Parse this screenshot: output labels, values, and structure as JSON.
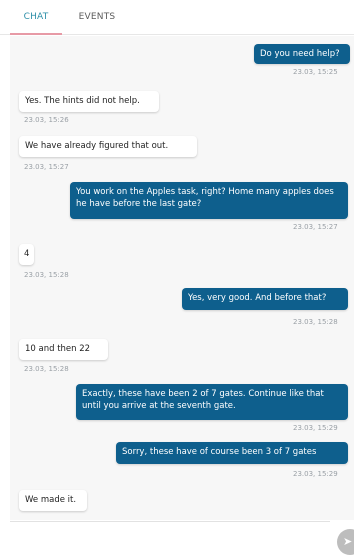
{
  "tabs": {
    "chat": "CHAT",
    "events": "EVENTS"
  },
  "messages": [
    {
      "direction": "out",
      "text": "Do you need help?",
      "time": "23.03, 15:25"
    },
    {
      "direction": "in",
      "text": "Yes. The hints did not help.",
      "time": "23.03, 15:26"
    },
    {
      "direction": "in",
      "text": "We have already figured that out.",
      "time": "23.03, 15:27"
    },
    {
      "direction": "out",
      "text": "You work on the Apples task, right? Home many apples does he have before the last gate?",
      "time": "23.03, 15:27"
    },
    {
      "direction": "in",
      "text": "4",
      "time": "23.03, 15:28"
    },
    {
      "direction": "out",
      "text": "Yes, very good. And before that?",
      "time": "23.03, 15:28"
    },
    {
      "direction": "in",
      "text": "10 and then 22",
      "time": "23.03, 15:28"
    },
    {
      "direction": "out",
      "text": "Exactly, these have been 2 of 7 gates. Continue like that until you arrive at the seventh gate.",
      "time": "23.03, 15:29"
    },
    {
      "direction": "out",
      "text": "Sorry, these have of course been 3 of 7 gates",
      "time": "23.03, 15:29"
    },
    {
      "direction": "in",
      "text": "We made it.",
      "time": ""
    }
  ],
  "composer": {
    "send_icon": "send-icon",
    "send_glyph": "➤",
    "input_value": ""
  },
  "colors": {
    "accent": "#2e8fa8",
    "outgoing_bubble": "#0e5f8d",
    "incoming_bubble": "#ffffff",
    "tab_indicator": "#e79aa6",
    "chat_background": "#f7f7f7"
  }
}
